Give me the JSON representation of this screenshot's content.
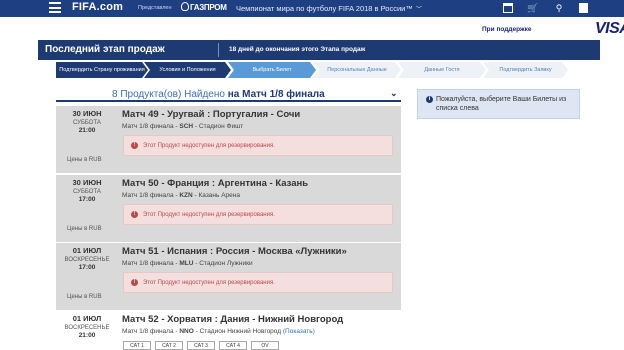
{
  "header": {
    "logo": "FIFA.com",
    "presented_by": "Представлен",
    "partner": "ГАЗПРОМ",
    "tournament": "Чемпионат мира по футболу FIFA 2018 в России™"
  },
  "sponsor": {
    "text": "При поддержке",
    "brand": "VISA"
  },
  "phase": {
    "title": "Последний этап продаж",
    "days_left": "18 дней до окончания этого Этапа продаж"
  },
  "steps": [
    {
      "label": "Подтвердить Страну проживания",
      "state": "done"
    },
    {
      "label": "Условия и Положения",
      "state": "done"
    },
    {
      "label": "Выбрать Билет",
      "state": "active"
    },
    {
      "label": "Персональные Данные",
      "state": "pending"
    },
    {
      "label": "Данные Гостя",
      "state": "pending"
    },
    {
      "label": "Подтвердить Заявку",
      "state": "pending"
    }
  ],
  "products": {
    "count_text": "8 Продукта(ов) Найдено",
    "match_text": "на Матч 1/8 финала"
  },
  "matches": [
    {
      "date": "30 ИЮН",
      "weekday": "СУББОТА",
      "time": "21:00",
      "prices": "Цены в RUB",
      "title": "Матч 49 - Уругвай : Португалия - Сочи",
      "round": "Матч 1/8 финала -",
      "code": "SCH",
      "venue": "- Стадион Фишт",
      "alert": "Этот Продукт недоступен для резервирования."
    },
    {
      "date": "30 ИЮН",
      "weekday": "СУББОТА",
      "time": "17:00",
      "prices": "Цены в RUB",
      "title": "Матч 50 - Франция : Аргентина - Казань",
      "round": "Матч 1/8 финала -",
      "code": "KZN",
      "venue": "- Казань Арена",
      "alert": "Этот Продукт недоступен для резервирования."
    },
    {
      "date": "01 ИЮЛ",
      "weekday": "ВОСКРЕСЕНЬЕ",
      "time": "17:00",
      "prices": "Цены в RUB",
      "title": "Матч 51 - Испания : Россия - Москва «Лужники»",
      "round": "Матч 1/8 финала -",
      "code": "MLU",
      "venue": "- Стадион Лужники",
      "alert": "Этот Продукт недоступен для резервирования."
    },
    {
      "date": "01 ИЮЛ",
      "weekday": "ВОСКРЕСЕНЬЕ",
      "time": "21:00",
      "title": "Матч 52 - Хорватия : Дания - Нижний Новгород",
      "round": "Матч 1/8 финала -",
      "code": "NNO",
      "venue": "- Стадион Нижний Новгород",
      "show_link": "(Показать)",
      "categories": [
        "CAT 1",
        "CAT 2",
        "CAT 3",
        "CAT 4",
        "OV"
      ]
    }
  ],
  "infobox": {
    "text": "Пожалуйста, выберите Ваши Билеты из списка слева"
  },
  "colors": {
    "nav": "#1f3f83",
    "active_step": "#5a9ad6",
    "alert_bg": "#f4dede",
    "alert_text": "#b94a48"
  },
  "icons": [
    "menu-icon",
    "calendar-icon",
    "cart-icon",
    "search-icon",
    "user-icon",
    "chevron-down-icon",
    "error-icon",
    "info-icon"
  ]
}
